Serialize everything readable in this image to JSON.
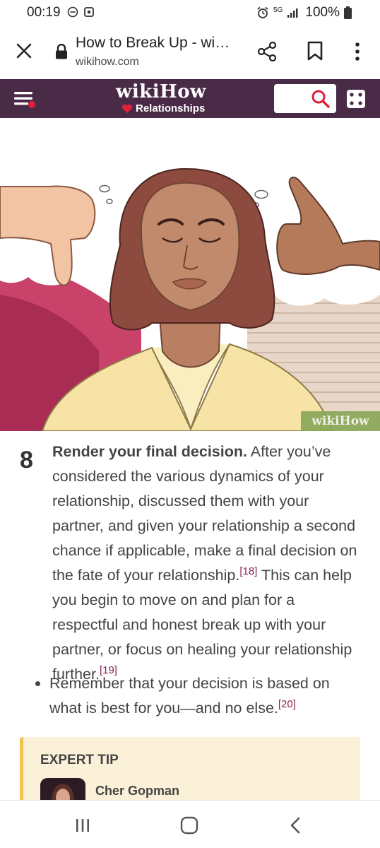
{
  "status_bar": {
    "time": "00:19",
    "network": "5G",
    "battery": "100%"
  },
  "browser": {
    "title": "How to Break Up - wi…",
    "url": "wikihow.com"
  },
  "site_header": {
    "logo": "wikiHow",
    "section": "Relationships"
  },
  "hero": {
    "credit": "wikiHow"
  },
  "step": {
    "number": "8",
    "title": "Render your final decision.",
    "text_part1": " After you’ve considered the various dynamics of your relationship, discussed them with your partner, and given your relationship a second chance if applicable, make a final decision on the fate of your relationship.",
    "ref1": "[18]",
    "text_part2": " This can help you begin to move on and plan for a respectful and honest break up with your partner, or focus on healing your relationship further.",
    "ref2": "[19]"
  },
  "bullet": {
    "text": "Remember that your decision is based on what is best for you—and no else.",
    "ref": "[20]"
  },
  "expert_tip": {
    "label": "EXPERT TIP",
    "name": "Cher Gopman"
  },
  "colors": {
    "header_bg": "#4a2b47",
    "ref_color": "#8a2357",
    "tip_bg": "#fbf0d8",
    "tip_accent": "#f2c14e"
  }
}
